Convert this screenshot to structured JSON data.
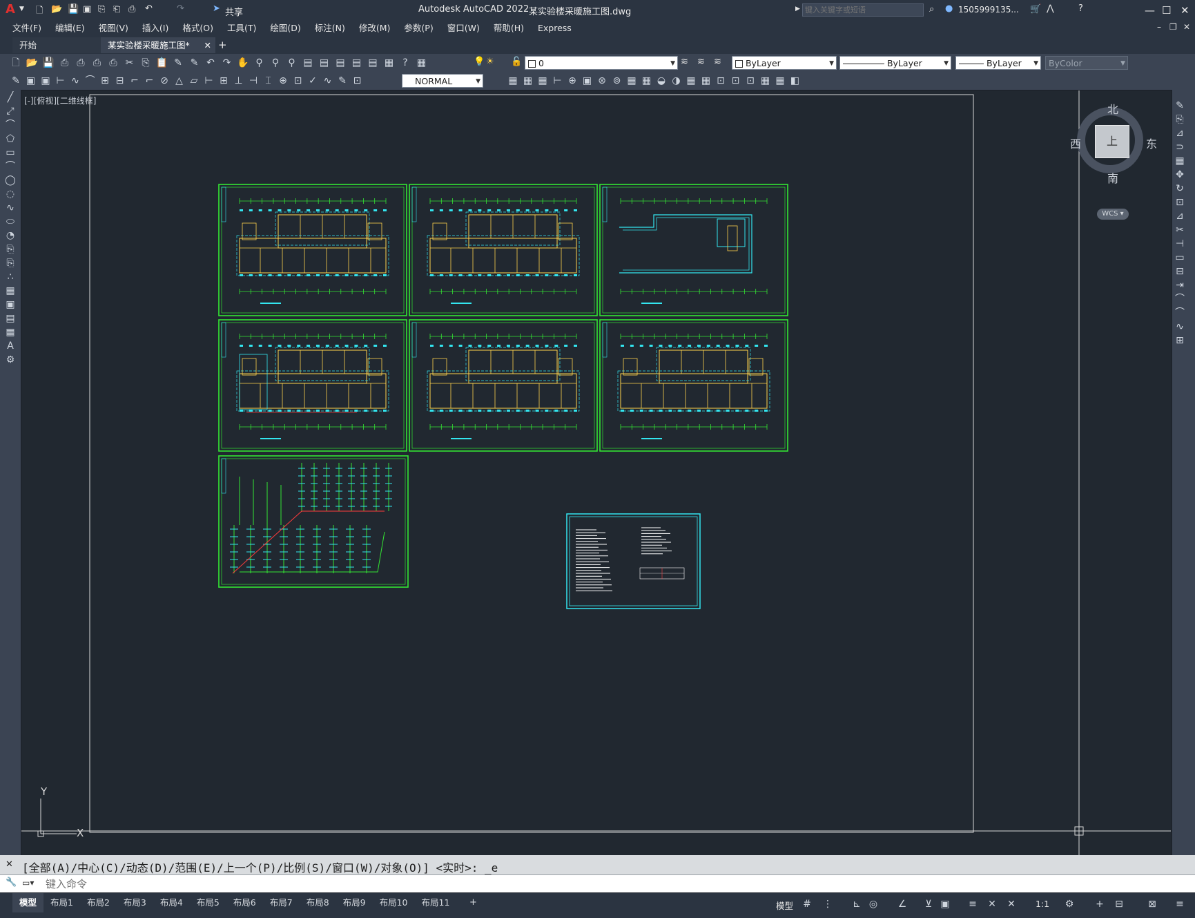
{
  "app": {
    "title": "Autodesk AutoCAD 2022",
    "document": "某实验楼采暖施工图.dwg",
    "logo": "A",
    "share_label": "共享"
  },
  "search": {
    "placeholder": "键入关键字或短语"
  },
  "account": {
    "user": "1505999135..."
  },
  "menu": [
    "文件(F)",
    "编辑(E)",
    "视图(V)",
    "插入(I)",
    "格式(O)",
    "工具(T)",
    "绘图(D)",
    "标注(N)",
    "修改(M)",
    "参数(P)",
    "窗口(W)",
    "帮助(H)",
    "Express"
  ],
  "tabs": {
    "start": "开始",
    "active": "某实验楼采暖施工图*",
    "add": "+"
  },
  "properties": {
    "layer": "0",
    "color": "ByLayer",
    "linetype": "ByLayer",
    "lineweight": "ByLayer",
    "plotstyle": "ByColor",
    "dimstyle": "NORMAL"
  },
  "viewport": {
    "label": "[-][俯视][二维线框]"
  },
  "viewcube": {
    "north": "北",
    "south": "南",
    "east": "东",
    "west": "西",
    "face": "上",
    "wcs": "WCS"
  },
  "ucs": {
    "y": "Y",
    "x": "X"
  },
  "command": {
    "history": "[全部(A)/中心(C)/动态(D)/范围(E)/上一个(P)/比例(S)/窗口(W)/对象(O)] <实时>: _e",
    "placeholder": "键入命令"
  },
  "layouts": [
    "模型",
    "布局1",
    "布局2",
    "布局3",
    "布局4",
    "布局5",
    "布局6",
    "布局7",
    "布局8",
    "布局9",
    "布局10",
    "布局11"
  ],
  "status": {
    "model": "模型",
    "scale": "1:1"
  }
}
